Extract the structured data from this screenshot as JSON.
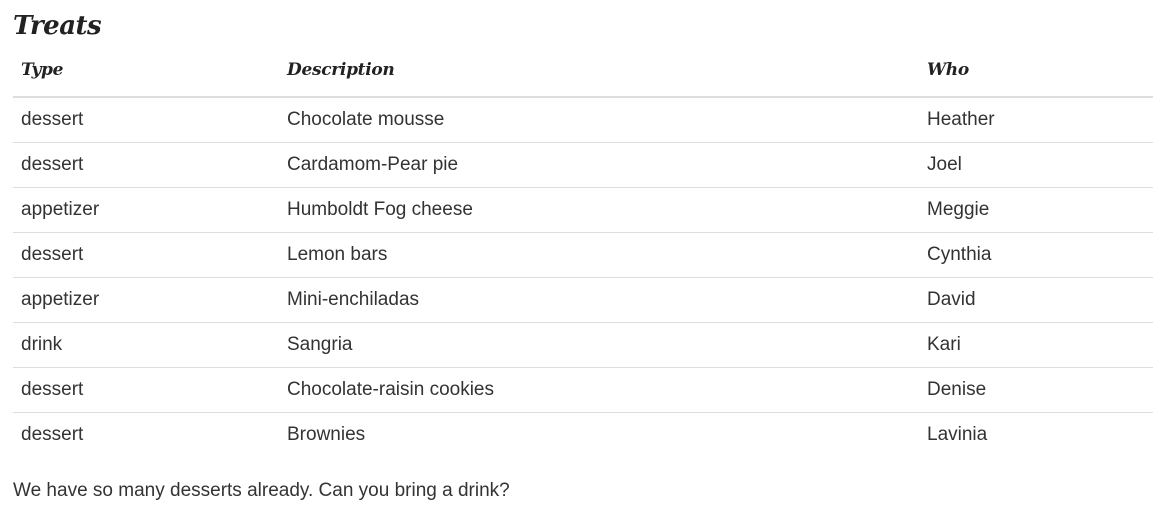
{
  "title": "Treats",
  "table": {
    "headers": [
      "Type",
      "Description",
      "Who"
    ],
    "rows": [
      [
        "dessert",
        "Chocolate mousse",
        "Heather"
      ],
      [
        "dessert",
        "Cardamom-Pear pie",
        "Joel"
      ],
      [
        "appetizer",
        "Humboldt Fog cheese",
        "Meggie"
      ],
      [
        "dessert",
        "Lemon bars",
        "Cynthia"
      ],
      [
        "appetizer",
        "Mini-enchiladas",
        "David"
      ],
      [
        "drink",
        "Sangria",
        "Kari"
      ],
      [
        "dessert",
        "Chocolate-raisin cookies",
        "Denise"
      ],
      [
        "dessert",
        "Brownies",
        "Lavinia"
      ]
    ]
  },
  "note": "We have so many desserts already. Can you bring a drink?",
  "colors": {
    "text": "#333333",
    "heading": "#222222",
    "rule": "#dddddd",
    "background": "#ffffff"
  }
}
